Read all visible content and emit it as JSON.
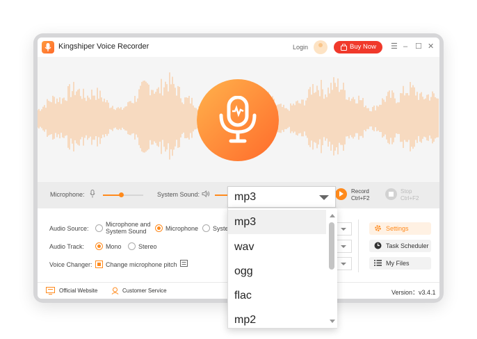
{
  "app": {
    "title": "Kingshiper Voice Recorder",
    "login_label": "Login",
    "buy_label": "Buy Now"
  },
  "window_controls": {
    "menu": "☰",
    "minimize": "–",
    "maximize": "☐",
    "close": "✕"
  },
  "controls": {
    "microphone_label": "Microphone:",
    "microphone_level": 0.45,
    "system_sound_label": "System Sound:",
    "record_label": "Record",
    "record_shortcut": "Ctrl+F2",
    "stop_label": "Stop",
    "stop_shortcut": "Ctrl+F2"
  },
  "settings": {
    "audio_source_label": "Audio Source:",
    "audio_source_options": [
      "Microphone and System Sound",
      "Microphone",
      "System Sound"
    ],
    "audio_source_option0_line1": "Microphone and",
    "audio_source_option0_line2": "System Sound",
    "audio_source_option1": "Microphone",
    "audio_source_option2_visible": "Syste",
    "audio_source_selected": "Microphone",
    "audio_track_label": "Audio Track:",
    "audio_track_mono": "Mono",
    "audio_track_stereo": "Stereo",
    "audio_track_selected": "Mono",
    "voice_changer_label": "Voice Changer:",
    "voice_changer_option": "Change microphone pitch",
    "voice_changer_checked": true
  },
  "side_buttons": {
    "settings": "Settings",
    "task_scheduler": "Task Scheduler",
    "my_files": "My Files"
  },
  "footer": {
    "official_website": "Official Website",
    "customer_service": "Customer Service",
    "version": "Version：v3.4.1"
  },
  "format_dropdown": {
    "selected": "mp3",
    "options": [
      "mp3",
      "wav",
      "ogg",
      "flac",
      "mp2"
    ]
  },
  "colors": {
    "accent": "#ff8a1c",
    "buy": "#f0392b",
    "wave": "#f9c08a"
  }
}
